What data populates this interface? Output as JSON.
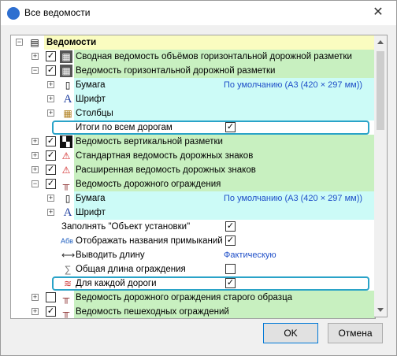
{
  "window": {
    "title": "Все ведомости",
    "close": "✕"
  },
  "tree": {
    "root": "Ведомости",
    "rows": [
      {
        "label": "Сводная ведомость объёмов горизонтальной дорожной разметки",
        "checked": "✓"
      },
      {
        "label": "Ведомость горизонтальной дорожной разметки",
        "checked": "✓"
      },
      {
        "label": "Бумага",
        "value": "По умолчанию (А3 (420 × 297 мм))"
      },
      {
        "label": "Шрифт"
      },
      {
        "label": "Столбцы"
      },
      {
        "label": "Итоги по всем дорогам",
        "value": "✓"
      },
      {
        "label": "Ведомость вертикальной разметки",
        "checked": "✓"
      },
      {
        "label": "Стандартная ведомость дорожных знаков",
        "checked": "✓"
      },
      {
        "label": "Расширенная ведомость дорожных знаков",
        "checked": "✓"
      },
      {
        "label": "Ведомость дорожного ограждения",
        "checked": "✓"
      },
      {
        "label": "Бумага",
        "value": "По умолчанию (А3 (420 × 297 мм))"
      },
      {
        "label": "Шрифт"
      },
      {
        "label": "Заполнять \"Объект установки\"",
        "value": "✓"
      },
      {
        "label": "Отображать названия примыканий",
        "value": "✓"
      },
      {
        "label": "Выводить длину",
        "value": "Фактическую"
      },
      {
        "label": "Общая длина ограждения",
        "value": ""
      },
      {
        "label": "Для каждой дороги",
        "value": "✓"
      },
      {
        "label": "Ведомость дорожного ограждения старого образца",
        "checked": ""
      },
      {
        "label": "Ведомость пешеходных ограждений",
        "checked": "✓"
      }
    ],
    "glyphs": {
      "expand": "+",
      "collapse": "−",
      "font": "A",
      "sigma": "∑",
      "abv": "Абв"
    }
  },
  "buttons": {
    "ok": "OK",
    "cancel": "Отмена"
  }
}
